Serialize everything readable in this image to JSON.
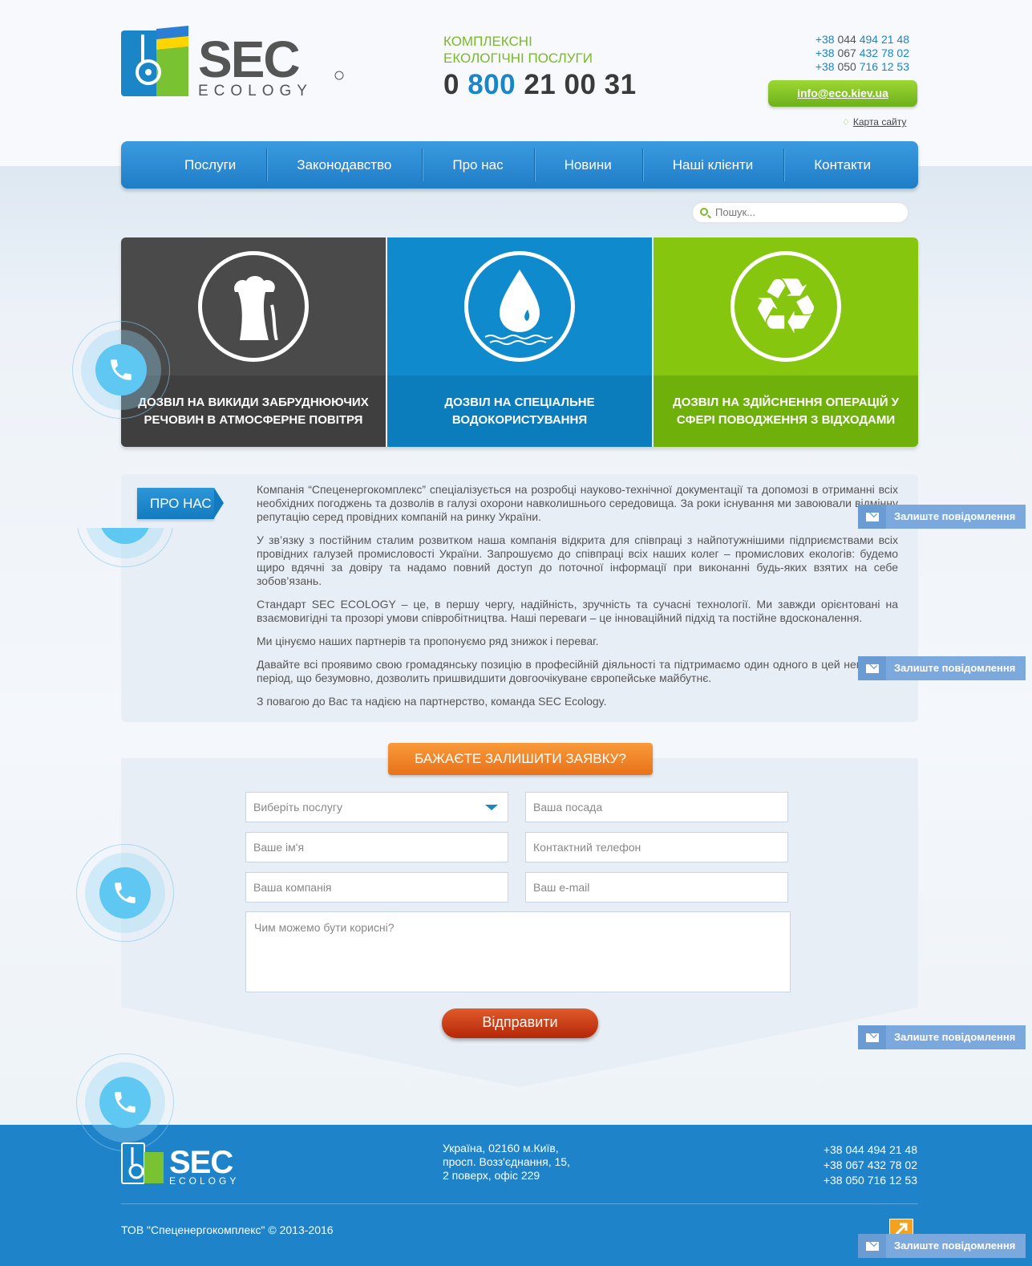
{
  "header": {
    "logo_text": "SEC",
    "logo_sub": "ECOLOGY",
    "tagline_line1": "КОМПЛЕКСНІ",
    "tagline_line2": "ЕКОЛОГІЧНІ ПОСЛУГИ",
    "hotline_a": "0",
    "hotline_b": "800",
    "hotline_c": "21 00 31",
    "phones": [
      {
        "code": "+38",
        "op": "044",
        "num": "494 21 48"
      },
      {
        "code": "+38",
        "op": "067",
        "num": "432 78 02"
      },
      {
        "code": "+38",
        "op": "050",
        "num": "716 12 53"
      }
    ],
    "email": "info@eco.kiev.ua",
    "sitemap": "Карта сайту"
  },
  "nav": [
    "Послуги",
    "Законодавство",
    "Про нас",
    "Новини",
    "Наші клієнти",
    "Контакти"
  ],
  "search": {
    "placeholder": "Пошук..."
  },
  "tiles": [
    {
      "label": "ДОЗВІЛ НА ВИКИДИ ЗАБРУДНЮЮЧИХ РЕЧОВИН В АТМОСФЕРНЕ ПОВІТРЯ",
      "icon": "factory-icon"
    },
    {
      "label": "ДОЗВІЛ НА СПЕЦІАЛЬНЕ ВОДОКОРИСТУВАННЯ",
      "icon": "water-drop-icon"
    },
    {
      "label": "ДОЗВІЛ НА ЗДІЙСНЕННЯ ОПЕРАЦІЙ У СФЕРІ ПОВОДЖЕННЯ З ВІДХОДАМИ",
      "icon": "recycle-icon"
    }
  ],
  "about": {
    "tag": "ПРО НАС",
    "paragraphs": [
      "Компанія “Спеценергокомплекс” спеціалізується на розробці науково-технічної документації та допомозі в отриманні всіх необхідних погоджень та дозволів в галузі охорони навколишнього середовища. За роки існування ми завоювали відмінну репутацію серед провідних компаній на ринку України.",
      "У зв’язку з постійним сталим розвитком наша компанія відкрита для співпраці з найпотужнішими підприємствами всіх провідних галузей промисловості України. Запрошуємо до співпраці всіх наших колег – промислових екологів: будемо щиро вдячні за довіру та надамо повний доступ до поточної інформації при виконанні будь-яких взятих на себе зобов’язань.",
      "Стандарт SEC ECOLOGY – це, в першу чергу, надійність, зручність та сучасні технології. Ми завжди орієнтовані на взаємовигідні та прозорі умови співробітництва. Наші переваги – це інноваційний підхід та постійне вдосконалення.",
      "Ми цінуємо наших партнерів та пропонуємо ряд знижок і переваг.",
      "Давайте всі проявимо свою громадянську позицію в професійній діяльності та підтримаємо один одного в цей непростий період, що безумовно, дозволить пришвидшити довгоочікуване європейське майбутнє.",
      "З повагою до Вас та надією на партнерство, команда SEC Ecology."
    ]
  },
  "form": {
    "title": "БАЖАЄТЕ ЗАЛИШИТИ ЗАЯВКУ?",
    "service": "Виберіть послугу",
    "position": "Ваша посада",
    "name": "Ваше ім'я",
    "phone": "Контактний телефон",
    "company": "Ваша компанія",
    "email": "Ваш e-mail",
    "message": "Чим можемо бути корисні?",
    "submit": "Відправити"
  },
  "message_tab": "Залиште повідомлення",
  "footer": {
    "address": [
      "Україна, 02160 м.Київ,",
      "просп. Возз'єднання, 15,",
      "2 поверх, офіс 229"
    ],
    "phones": [
      "+38 044 494 21 48",
      "+38 067 432 78 02",
      "+38 050 716 12 53"
    ],
    "copyright": "ТОВ \"Спеценергокомплекс\" © 2013-2016"
  },
  "colors": {
    "green": "#7ab928",
    "blue": "#1a86c8",
    "orange": "#f08a2c",
    "red": "#c83a14",
    "footer": "#1e83c8"
  }
}
